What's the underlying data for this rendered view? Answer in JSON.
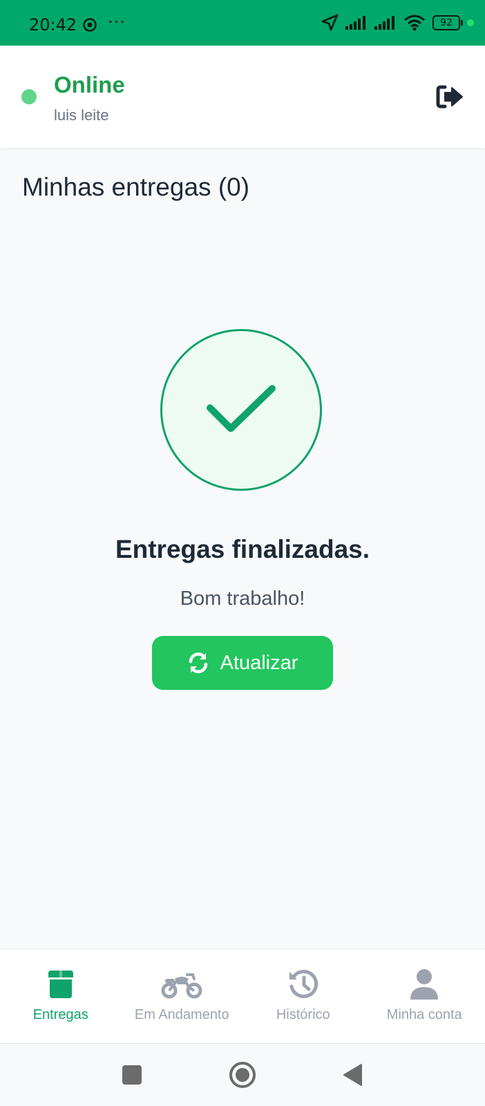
{
  "status_bar": {
    "time": "20:42",
    "more_indicator": "···",
    "battery": "92"
  },
  "header": {
    "status": "Online",
    "user_name": "luis leite"
  },
  "main": {
    "title": "Minhas entregas (0)",
    "empty_title": "Entregas finalizadas.",
    "empty_subtitle": "Bom trabalho!",
    "refresh_label": "Atualizar"
  },
  "bottom_nav": {
    "items": [
      {
        "label": "Entregas",
        "icon": "box-icon",
        "active": true
      },
      {
        "label": "Em Andamento",
        "icon": "motorcycle-icon",
        "active": false
      },
      {
        "label": "Histórico",
        "icon": "history-icon",
        "active": false
      },
      {
        "label": "Minha conta",
        "icon": "user-icon",
        "active": false
      }
    ]
  },
  "colors": {
    "status_bar": "#00a96b",
    "online": "#1e9e4e",
    "accent": "#10a36b",
    "button": "#22c55e",
    "inactive": "#9ca3af"
  }
}
